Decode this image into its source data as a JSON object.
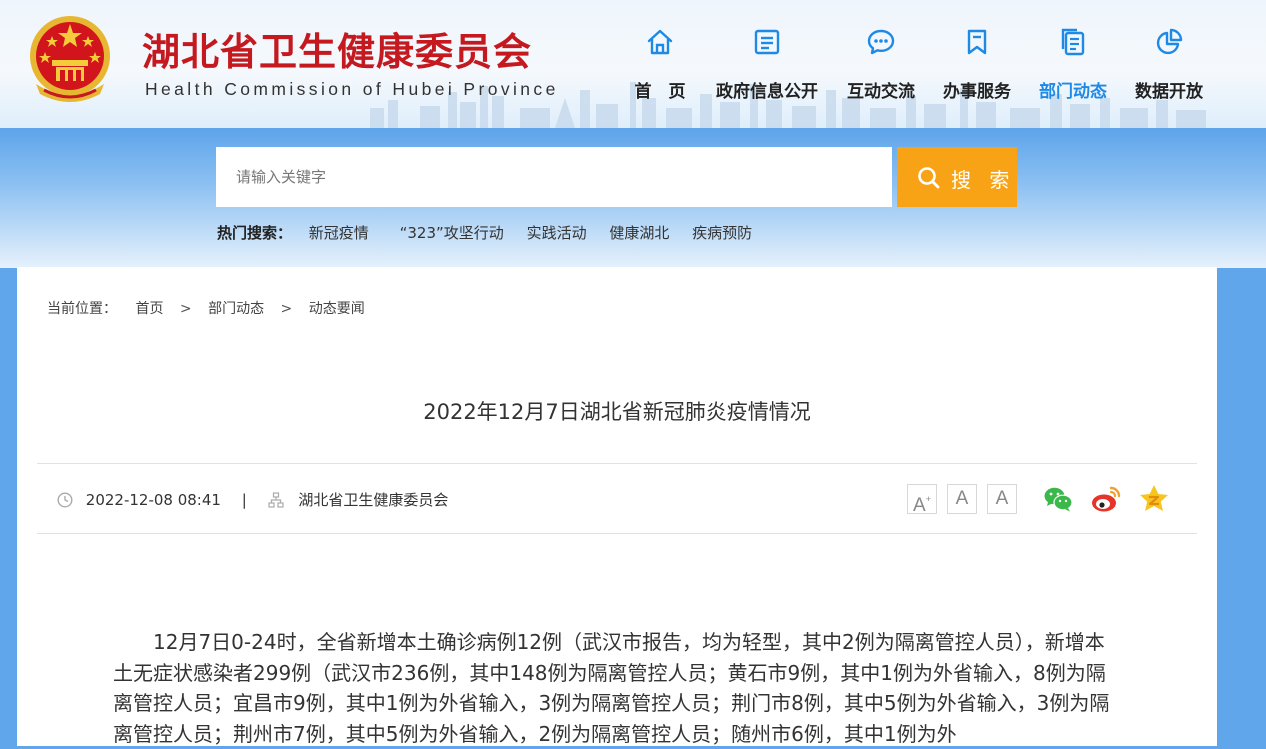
{
  "header": {
    "site_title": "湖北省卫生健康委员会",
    "site_subtitle": "Health Commission of Hubei Province",
    "brand_red": "#c4191f",
    "nav": [
      {
        "label": "首　页",
        "icon": "home-icon",
        "active": false
      },
      {
        "label": "政府信息公开",
        "icon": "document-list-icon",
        "active": false
      },
      {
        "label": "互动交流",
        "icon": "chat-bubble-icon",
        "active": false
      },
      {
        "label": "办事服务",
        "icon": "bookmark-icon",
        "active": false
      },
      {
        "label": "部门动态",
        "icon": "news-copy-icon",
        "active": true
      },
      {
        "label": "数据开放",
        "icon": "pie-chart-icon",
        "active": false
      }
    ],
    "nav_color": "#1e8ae6"
  },
  "search": {
    "placeholder": "请输入关键字",
    "button_label": "搜 索",
    "button_color": "#f8a316",
    "hot_label": "热门搜索：",
    "hot_terms": [
      "新冠疫情",
      "“323”攻坚行动",
      "实践活动",
      "健康湖北",
      "疾病预防"
    ]
  },
  "breadcrumb": {
    "label": "当前位置：",
    "items": [
      "首页",
      "部门动态",
      "动态要闻"
    ],
    "separator": ">"
  },
  "article": {
    "title": "2022年12月7日湖北省新冠肺炎疫情情况",
    "date": "2022-12-08 08:41",
    "divider": "|",
    "source": "湖北省卫生健康委员会",
    "font_sizes": [
      "A",
      "A",
      "A"
    ],
    "font_plus_mark": "+",
    "share": [
      "wechat-icon",
      "weibo-icon",
      "qzone-icon"
    ],
    "body": "12月7日0-24时，全省新增本土确诊病例12例（武汉市报告，均为轻型，其中2例为隔离管控人员），新增本土无症状感染者299例（武汉市236例，其中148例为隔离管控人员；黄石市9例，其中1例为外省输入，8例为隔离管控人员；宜昌市9例，其中1例为外省输入，3例为隔离管控人员；荆门市8例，其中5例为外省输入，3例为隔离管控人员；荆州市7例，其中5例为外省输入，2例为隔离管控人员；随州市6例，其中1例为外"
  }
}
